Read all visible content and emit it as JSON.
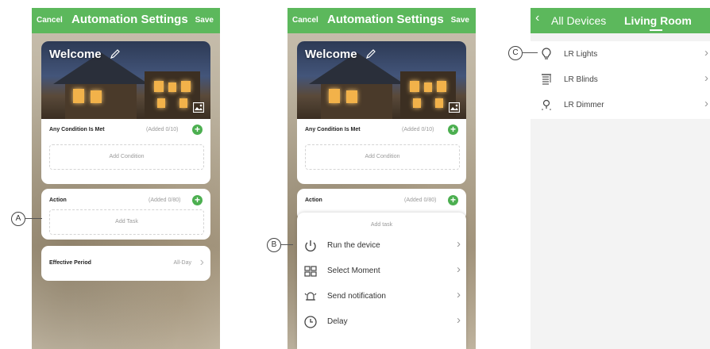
{
  "screen1": {
    "header": {
      "cancel": "Cancel",
      "title": "Automation Settings",
      "save": "Save"
    },
    "scene": {
      "name": "Welcome"
    },
    "conditions": {
      "label": "Any Condition Is Met",
      "added": "(Added 0/10)",
      "add_label": "Add Condition"
    },
    "action": {
      "label": "Action",
      "added": "(Added 0/80)",
      "add_label": "Add Task"
    },
    "period": {
      "label": "Effective Period",
      "value": "All-Day"
    },
    "callout": "A"
  },
  "screen2": {
    "header": {
      "cancel": "Cancel",
      "title": "Automation Settings",
      "save": "Save"
    },
    "scene": {
      "name": "Welcome"
    },
    "conditions": {
      "label": "Any Condition Is Met",
      "added": "(Added 0/10)",
      "add_label": "Add Condition"
    },
    "action": {
      "label": "Action",
      "added": "(Added 0/80)"
    },
    "sheet": {
      "title": "Add task",
      "items": [
        {
          "label": "Run the device",
          "icon": "power-icon"
        },
        {
          "label": "Select Moment",
          "icon": "grid-icon"
        },
        {
          "label": "Send notification",
          "icon": "bell-icon"
        },
        {
          "label": "Delay",
          "icon": "clock-icon"
        }
      ]
    },
    "callout": "B"
  },
  "screen3": {
    "header": {
      "back": "All Devices",
      "current": "Living Room"
    },
    "devices": [
      {
        "label": "LR Lights",
        "icon": "bulb-icon"
      },
      {
        "label": "LR Blinds",
        "icon": "blinds-icon"
      },
      {
        "label": "LR Dimmer",
        "icon": "dimmer-icon"
      }
    ],
    "callout": "C"
  },
  "colors": {
    "accent": "#5cb85c",
    "plus": "#4caf50"
  }
}
